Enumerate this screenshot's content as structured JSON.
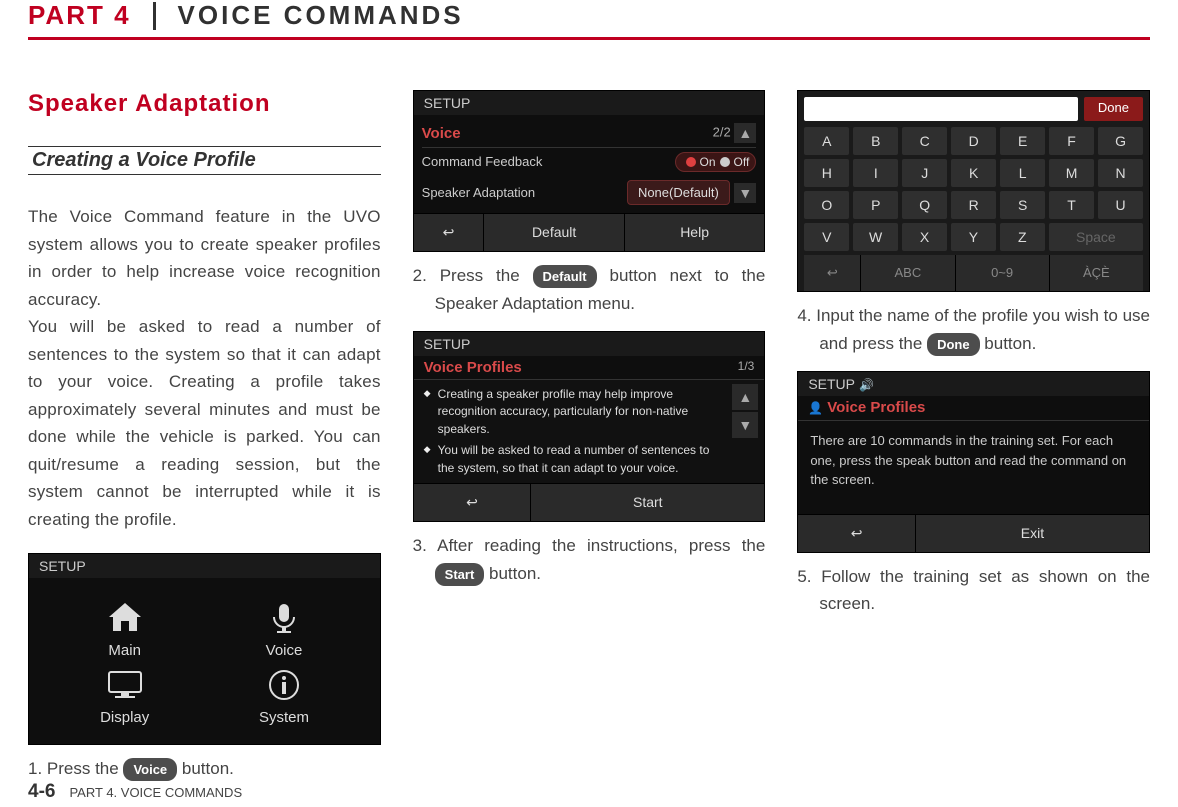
{
  "header": {
    "part": "PART 4",
    "title": "VOICE COMMANDS"
  },
  "section_title": "Speaker Adaptation",
  "sub_title": "Creating a Voice Profile",
  "intro": "The Voice Command feature in the UVO system allows you to create speaker profiles in order to help increase voice recognition accuracy.\nYou will be asked to read a number of sentences to the system so that it can adapt to your voice. Creating a profile takes approximately several minutes and must be done while the vehicle is parked. You can quit/resume a reading session, but the system cannot be interrupted while it is creating the profile.",
  "steps": {
    "s1a": "1. Press the ",
    "s1btn": "Voice",
    "s1b": " button.",
    "s2a": "2. Press the ",
    "s2btn": "Default",
    "s2b": " button next to the Speaker Adaptation menu.",
    "s3a": "3. After reading the instructions, press the ",
    "s3btn": "Start",
    "s3b": " button.",
    "s4a": "4. Input the name of the profile you wish to use and press the ",
    "s4btn": "Done",
    "s4b": " button.",
    "s5": "5. Follow the training set as shown on the screen."
  },
  "ss_setup": {
    "title": "SETUP",
    "items": [
      "Main",
      "Voice",
      "Display",
      "System"
    ]
  },
  "ss_voice_menu": {
    "title": "SETUP",
    "voice": "Voice",
    "page": "2/2",
    "row1": "Command Feedback",
    "on": "On",
    "off": "Off",
    "row2": "Speaker Adaptation",
    "none": "None(Default)",
    "back": "↩",
    "default": "Default",
    "help": "Help"
  },
  "ss_profiles": {
    "title": "SETUP",
    "heading": "Voice Profiles",
    "page": "1/3",
    "b1": "Creating a speaker profile may help improve recognition accuracy, particularly for non-native speakers.",
    "b2": "You will be asked to read a number of sentences to the system, so that it can adapt to your voice.",
    "back": "↩",
    "start": "Start"
  },
  "ss_keyboard": {
    "done": "Done",
    "rows": [
      [
        "A",
        "B",
        "C",
        "D",
        "E",
        "F",
        "G"
      ],
      [
        "H",
        "I",
        "J",
        "K",
        "L",
        "M",
        "N"
      ],
      [
        "O",
        "P",
        "Q",
        "R",
        "S",
        "T",
        "U"
      ],
      [
        "V",
        "W",
        "X",
        "Y",
        "Z"
      ]
    ],
    "space": "Space",
    "back": "↩",
    "abc": "ABC",
    "num": "0~9",
    "sym": "ÀÇÈ"
  },
  "ss_training": {
    "title": "SETUP",
    "heading": "Voice Profiles",
    "text": "There are 10 commands in the training set. For each one, press the speak button and read the command on the screen.",
    "back": "↩",
    "exit": "Exit"
  },
  "footer": {
    "page": "4-6",
    "part": "PART 4. VOICE COMMANDS"
  }
}
